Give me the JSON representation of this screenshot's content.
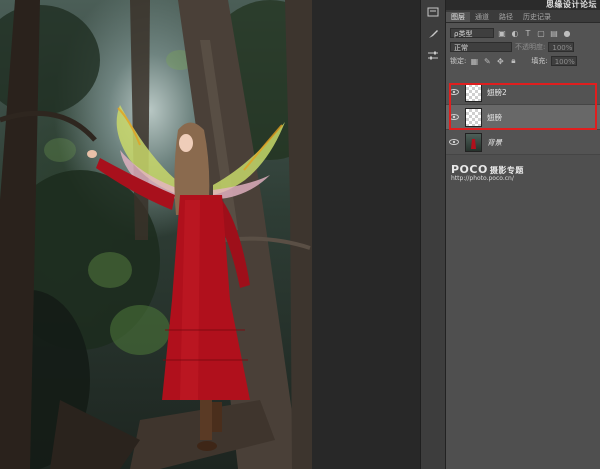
{
  "panel": {
    "watermark_top": "思缘设计论坛",
    "tabs": [
      {
        "label": "图层"
      },
      {
        "label": "通道"
      },
      {
        "label": "路径"
      },
      {
        "label": "历史记录"
      }
    ],
    "filter": {
      "label": "ρ类型"
    },
    "blend_mode": {
      "value": "正常"
    },
    "opacity": {
      "label": "不透明度:",
      "value": "100%"
    },
    "lock": {
      "label": "锁定:"
    },
    "fill": {
      "label": "填充:",
      "value": "100%"
    },
    "layers": [
      {
        "name": "翅膀2",
        "selected": false
      },
      {
        "name": "翅膀",
        "selected": true
      },
      {
        "name": "背景",
        "selected": false
      }
    ]
  },
  "watermark": {
    "logo": "POCO",
    "logo_cn": "摄影专题",
    "url": "http://photo.poco.cn/"
  },
  "colors": {
    "highlight": "#e01e1e",
    "dress": "#b0101c",
    "panel_bg": "#535353"
  }
}
